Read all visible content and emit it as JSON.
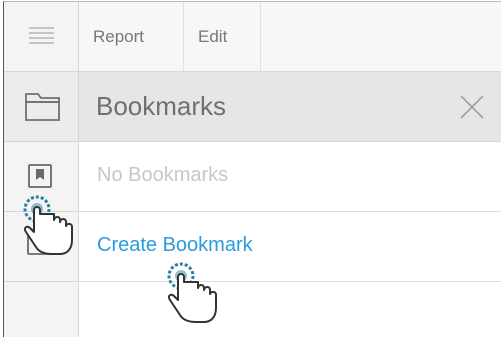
{
  "toolbar": {
    "tabs": [
      {
        "label": "Report"
      },
      {
        "label": "Edit"
      }
    ]
  },
  "sidebar": {
    "icons": [
      "menu-icon",
      "folder-icon",
      "bookmark-icon"
    ]
  },
  "bookmarks_panel": {
    "title": "Bookmarks",
    "empty_message": "No Bookmarks",
    "create_link": "Create Bookmark"
  },
  "colors": {
    "link": "#2b9be0",
    "cursor_ring": "#2b7fa6",
    "panel_header": "#e6e6e6"
  }
}
